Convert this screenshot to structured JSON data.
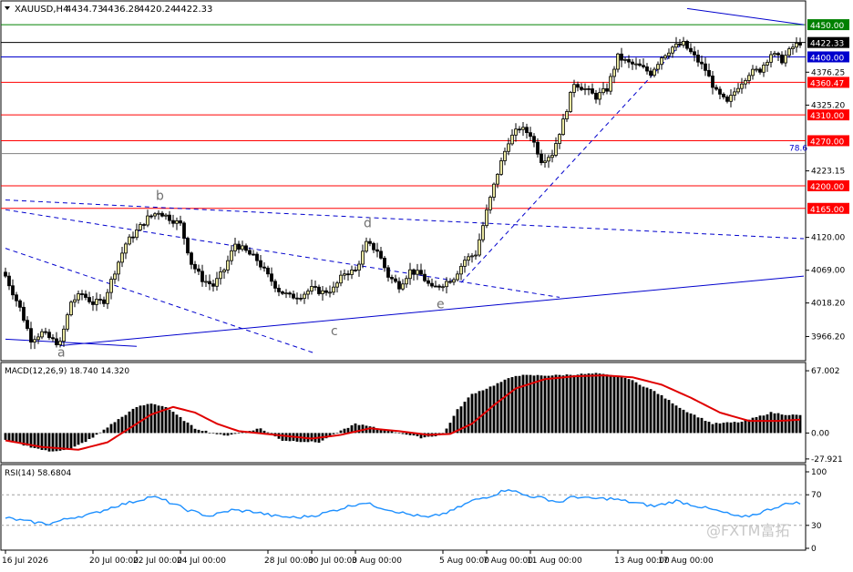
{
  "header": {
    "symbol": "XAUUSD,H4",
    "open": "4434.73",
    "high": "4436.28",
    "low": "4420.24",
    "close": "4422.33"
  },
  "watermark": "@FXTM富拓",
  "colors": {
    "bull": "#e8e6a0",
    "bear": "#000000",
    "support_resistance": "#ff0000",
    "blue_line": "#0000cd",
    "green_line": "#008000",
    "macd_signal": "#e00000",
    "rsi_line": "#1e90ff"
  },
  "price_panel": {
    "ylim": [
      3940,
      4460
    ],
    "axis_ticks": [
      {
        "value": 4376.25,
        "label": "4376.25"
      },
      {
        "value": 4325.2,
        "label": "4325.20"
      },
      {
        "value": 4223.15,
        "label": "4223.15"
      },
      {
        "value": 4120.0,
        "label": "4120.00"
      },
      {
        "value": 4069.0,
        "label": "4069.00"
      },
      {
        "value": 4018.2,
        "label": "4018.20"
      },
      {
        "value": 3966.2,
        "label": "3966.20"
      }
    ],
    "levels": [
      {
        "value": 4450.0,
        "label": "4450.00",
        "color": "#008000"
      },
      {
        "value": 4422.33,
        "label": "4422.33",
        "color": "#000000"
      },
      {
        "value": 4400.0,
        "label": "4400.00",
        "color": "#0000cd"
      },
      {
        "value": 4360.47,
        "label": "4360.47",
        "color": "#ff0000"
      },
      {
        "value": 4310.0,
        "label": "4310.00",
        "color": "#ff0000"
      },
      {
        "value": 4270.0,
        "label": "4270.00",
        "color": "#ff0000"
      },
      {
        "value": 4200.0,
        "label": "4200.00",
        "color": "#ff0000"
      },
      {
        "value": 4165.0,
        "label": "4165.00",
        "color": "#ff0000"
      }
    ],
    "fib_level": {
      "value": 4250.0,
      "label": "78.6"
    },
    "wave_labels": [
      {
        "label": "a",
        "bar": 15,
        "value": 3935
      },
      {
        "label": "b",
        "bar": 42,
        "value": 4178
      },
      {
        "label": "c",
        "bar": 90,
        "value": 3968
      },
      {
        "label": "d",
        "bar": 99,
        "value": 4136
      },
      {
        "label": "e",
        "bar": 119,
        "value": 4010
      }
    ],
    "trendlines": [
      {
        "from": [
          0,
          4178
        ],
        "to": [
          219,
          4118
        ],
        "style": "dashed",
        "color": "#0000cd"
      },
      {
        "from": [
          0,
          4163
        ],
        "to": [
          152,
          4027
        ],
        "style": "dashed",
        "color": "#0000cd"
      },
      {
        "from": [
          0,
          4103
        ],
        "to": [
          85,
          3940
        ],
        "style": "dashed",
        "color": "#0000cd"
      },
      {
        "from": [
          125,
          4050
        ],
        "to": [
          185,
          4418
        ],
        "style": "dashed",
        "color": "#0000cd"
      },
      {
        "from": [
          0,
          3962
        ],
        "to": [
          36,
          3951
        ],
        "style": "solid",
        "color": "#0000cd"
      },
      {
        "from": [
          15,
          3952
        ],
        "to": [
          219,
          4060
        ],
        "style": "solid",
        "color": "#0000cd"
      },
      {
        "from": [
          187,
          4475
        ],
        "to": [
          219,
          4450
        ],
        "style": "solid",
        "color": "#0000cd"
      }
    ]
  },
  "macd_panel": {
    "title": "MACD(12,26,9) 18.740 14.320",
    "ylim": [
      -30,
      70
    ],
    "axis_ticks": [
      {
        "value": 67.002,
        "label": "67.002"
      },
      {
        "value": 0.0,
        "label": "0.00"
      },
      {
        "value": -27.921,
        "label": "-27.921"
      }
    ]
  },
  "rsi_panel": {
    "title": "RSI(14) 58.6804",
    "ylim": [
      0,
      100
    ],
    "axis_ticks": [
      {
        "value": 100,
        "label": "100"
      },
      {
        "value": 70,
        "label": "70"
      },
      {
        "value": 30,
        "label": "30"
      },
      {
        "value": 0,
        "label": "0"
      }
    ],
    "levels": [
      70,
      30
    ]
  },
  "time_axis": [
    {
      "bar": 0,
      "label": "16 Jul 2026"
    },
    {
      "bar": 24,
      "label": "20 Jul 00:00"
    },
    {
      "bar": 36,
      "label": "22 Jul 00:00"
    },
    {
      "bar": 48,
      "label": "24 Jul 00:00"
    },
    {
      "bar": 72,
      "label": "28 Jul 00:00"
    },
    {
      "bar": 84,
      "label": "30 Jul 00:00"
    },
    {
      "bar": 96,
      "label": "3 Aug 00:00"
    },
    {
      "bar": 120,
      "label": "5 Aug 00:00"
    },
    {
      "bar": 132,
      "label": "7 Aug 00:00"
    },
    {
      "bar": 144,
      "label": "11 Aug 00:00"
    },
    {
      "bar": 168,
      "label": "13 Aug 00:00"
    },
    {
      "bar": 180,
      "label": "17 Aug 00:00"
    }
  ],
  "chart_data": {
    "type": "candlestick",
    "symbol": "XAUUSD",
    "timeframe": "H4",
    "bars": 219,
    "close_anchors": [
      [
        0,
        4060
      ],
      [
        4,
        4010
      ],
      [
        7,
        3962
      ],
      [
        10,
        3972
      ],
      [
        13,
        3960
      ],
      [
        15,
        3955
      ],
      [
        18,
        4020
      ],
      [
        21,
        4032
      ],
      [
        24,
        4018
      ],
      [
        27,
        4022
      ],
      [
        30,
        4068
      ],
      [
        33,
        4110
      ],
      [
        36,
        4130
      ],
      [
        39,
        4150
      ],
      [
        42,
        4160
      ],
      [
        45,
        4150
      ],
      [
        48,
        4140
      ],
      [
        51,
        4080
      ],
      [
        54,
        4055
      ],
      [
        57,
        4045
      ],
      [
        60,
        4070
      ],
      [
        63,
        4110
      ],
      [
        66,
        4098
      ],
      [
        69,
        4085
      ],
      [
        72,
        4060
      ],
      [
        75,
        4038
      ],
      [
        78,
        4028
      ],
      [
        81,
        4030
      ],
      [
        84,
        4040
      ],
      [
        87,
        4035
      ],
      [
        90,
        4040
      ],
      [
        93,
        4065
      ],
      [
        96,
        4068
      ],
      [
        99,
        4110
      ],
      [
        102,
        4100
      ],
      [
        105,
        4060
      ],
      [
        108,
        4045
      ],
      [
        111,
        4068
      ],
      [
        114,
        4062
      ],
      [
        117,
        4040
      ],
      [
        120,
        4048
      ],
      [
        123,
        4058
      ],
      [
        126,
        4085
      ],
      [
        129,
        4095
      ],
      [
        132,
        4160
      ],
      [
        135,
        4220
      ],
      [
        138,
        4270
      ],
      [
        141,
        4290
      ],
      [
        144,
        4280
      ],
      [
        147,
        4240
      ],
      [
        150,
        4250
      ],
      [
        153,
        4300
      ],
      [
        156,
        4360
      ],
      [
        159,
        4350
      ],
      [
        162,
        4338
      ],
      [
        165,
        4350
      ],
      [
        168,
        4400
      ],
      [
        171,
        4390
      ],
      [
        174,
        4385
      ],
      [
        177,
        4375
      ],
      [
        180,
        4400
      ],
      [
        183,
        4415
      ],
      [
        186,
        4420
      ],
      [
        189,
        4400
      ],
      [
        192,
        4380
      ],
      [
        195,
        4345
      ],
      [
        198,
        4328
      ],
      [
        201,
        4355
      ],
      [
        204,
        4375
      ],
      [
        207,
        4380
      ],
      [
        210,
        4405
      ],
      [
        213,
        4395
      ],
      [
        216,
        4415
      ],
      [
        218,
        4422.33
      ]
    ],
    "macd_histogram_anchors": [
      [
        0,
        -8
      ],
      [
        12,
        -20
      ],
      [
        18,
        -17
      ],
      [
        24,
        -5
      ],
      [
        30,
        12
      ],
      [
        36,
        28
      ],
      [
        40,
        32
      ],
      [
        44,
        28
      ],
      [
        52,
        5
      ],
      [
        60,
        -3
      ],
      [
        70,
        5
      ],
      [
        76,
        -8
      ],
      [
        86,
        -10
      ],
      [
        96,
        10
      ],
      [
        106,
        2
      ],
      [
        114,
        -5
      ],
      [
        120,
        -2
      ],
      [
        124,
        25
      ],
      [
        128,
        42
      ],
      [
        132,
        48
      ],
      [
        140,
        62
      ],
      [
        150,
        62
      ],
      [
        162,
        64
      ],
      [
        170,
        60
      ],
      [
        178,
        45
      ],
      [
        186,
        25
      ],
      [
        194,
        10
      ],
      [
        202,
        12
      ],
      [
        210,
        22
      ],
      [
        214,
        20
      ],
      [
        218,
        19
      ]
    ],
    "macd_signal_anchors": [
      [
        0,
        -8
      ],
      [
        10,
        -15
      ],
      [
        20,
        -18
      ],
      [
        28,
        -10
      ],
      [
        34,
        5
      ],
      [
        40,
        20
      ],
      [
        46,
        28
      ],
      [
        52,
        22
      ],
      [
        58,
        10
      ],
      [
        64,
        2
      ],
      [
        74,
        -2
      ],
      [
        84,
        -6
      ],
      [
        92,
        -2
      ],
      [
        100,
        5
      ],
      [
        108,
        2
      ],
      [
        116,
        -2
      ],
      [
        122,
        -1
      ],
      [
        128,
        10
      ],
      [
        134,
        30
      ],
      [
        140,
        48
      ],
      [
        148,
        58
      ],
      [
        156,
        61
      ],
      [
        164,
        62
      ],
      [
        172,
        60
      ],
      [
        180,
        52
      ],
      [
        188,
        38
      ],
      [
        196,
        22
      ],
      [
        204,
        13
      ],
      [
        212,
        13
      ],
      [
        218,
        14.32
      ]
    ],
    "rsi_anchors": [
      [
        0,
        40
      ],
      [
        6,
        35
      ],
      [
        12,
        32
      ],
      [
        18,
        40
      ],
      [
        24,
        45
      ],
      [
        30,
        55
      ],
      [
        36,
        62
      ],
      [
        40,
        68
      ],
      [
        44,
        62
      ],
      [
        50,
        50
      ],
      [
        56,
        42
      ],
      [
        62,
        50
      ],
      [
        68,
        48
      ],
      [
        74,
        42
      ],
      [
        80,
        40
      ],
      [
        86,
        44
      ],
      [
        92,
        52
      ],
      [
        98,
        60
      ],
      [
        104,
        52
      ],
      [
        110,
        45
      ],
      [
        116,
        40
      ],
      [
        122,
        48
      ],
      [
        128,
        62
      ],
      [
        134,
        70
      ],
      [
        138,
        78
      ],
      [
        142,
        70
      ],
      [
        148,
        65
      ],
      [
        152,
        60
      ],
      [
        156,
        68
      ],
      [
        160,
        65
      ],
      [
        166,
        65
      ],
      [
        172,
        60
      ],
      [
        178,
        55
      ],
      [
        184,
        62
      ],
      [
        190,
        55
      ],
      [
        196,
        48
      ],
      [
        202,
        40
      ],
      [
        206,
        45
      ],
      [
        212,
        55
      ],
      [
        216,
        60
      ],
      [
        218,
        58.68
      ]
    ]
  }
}
